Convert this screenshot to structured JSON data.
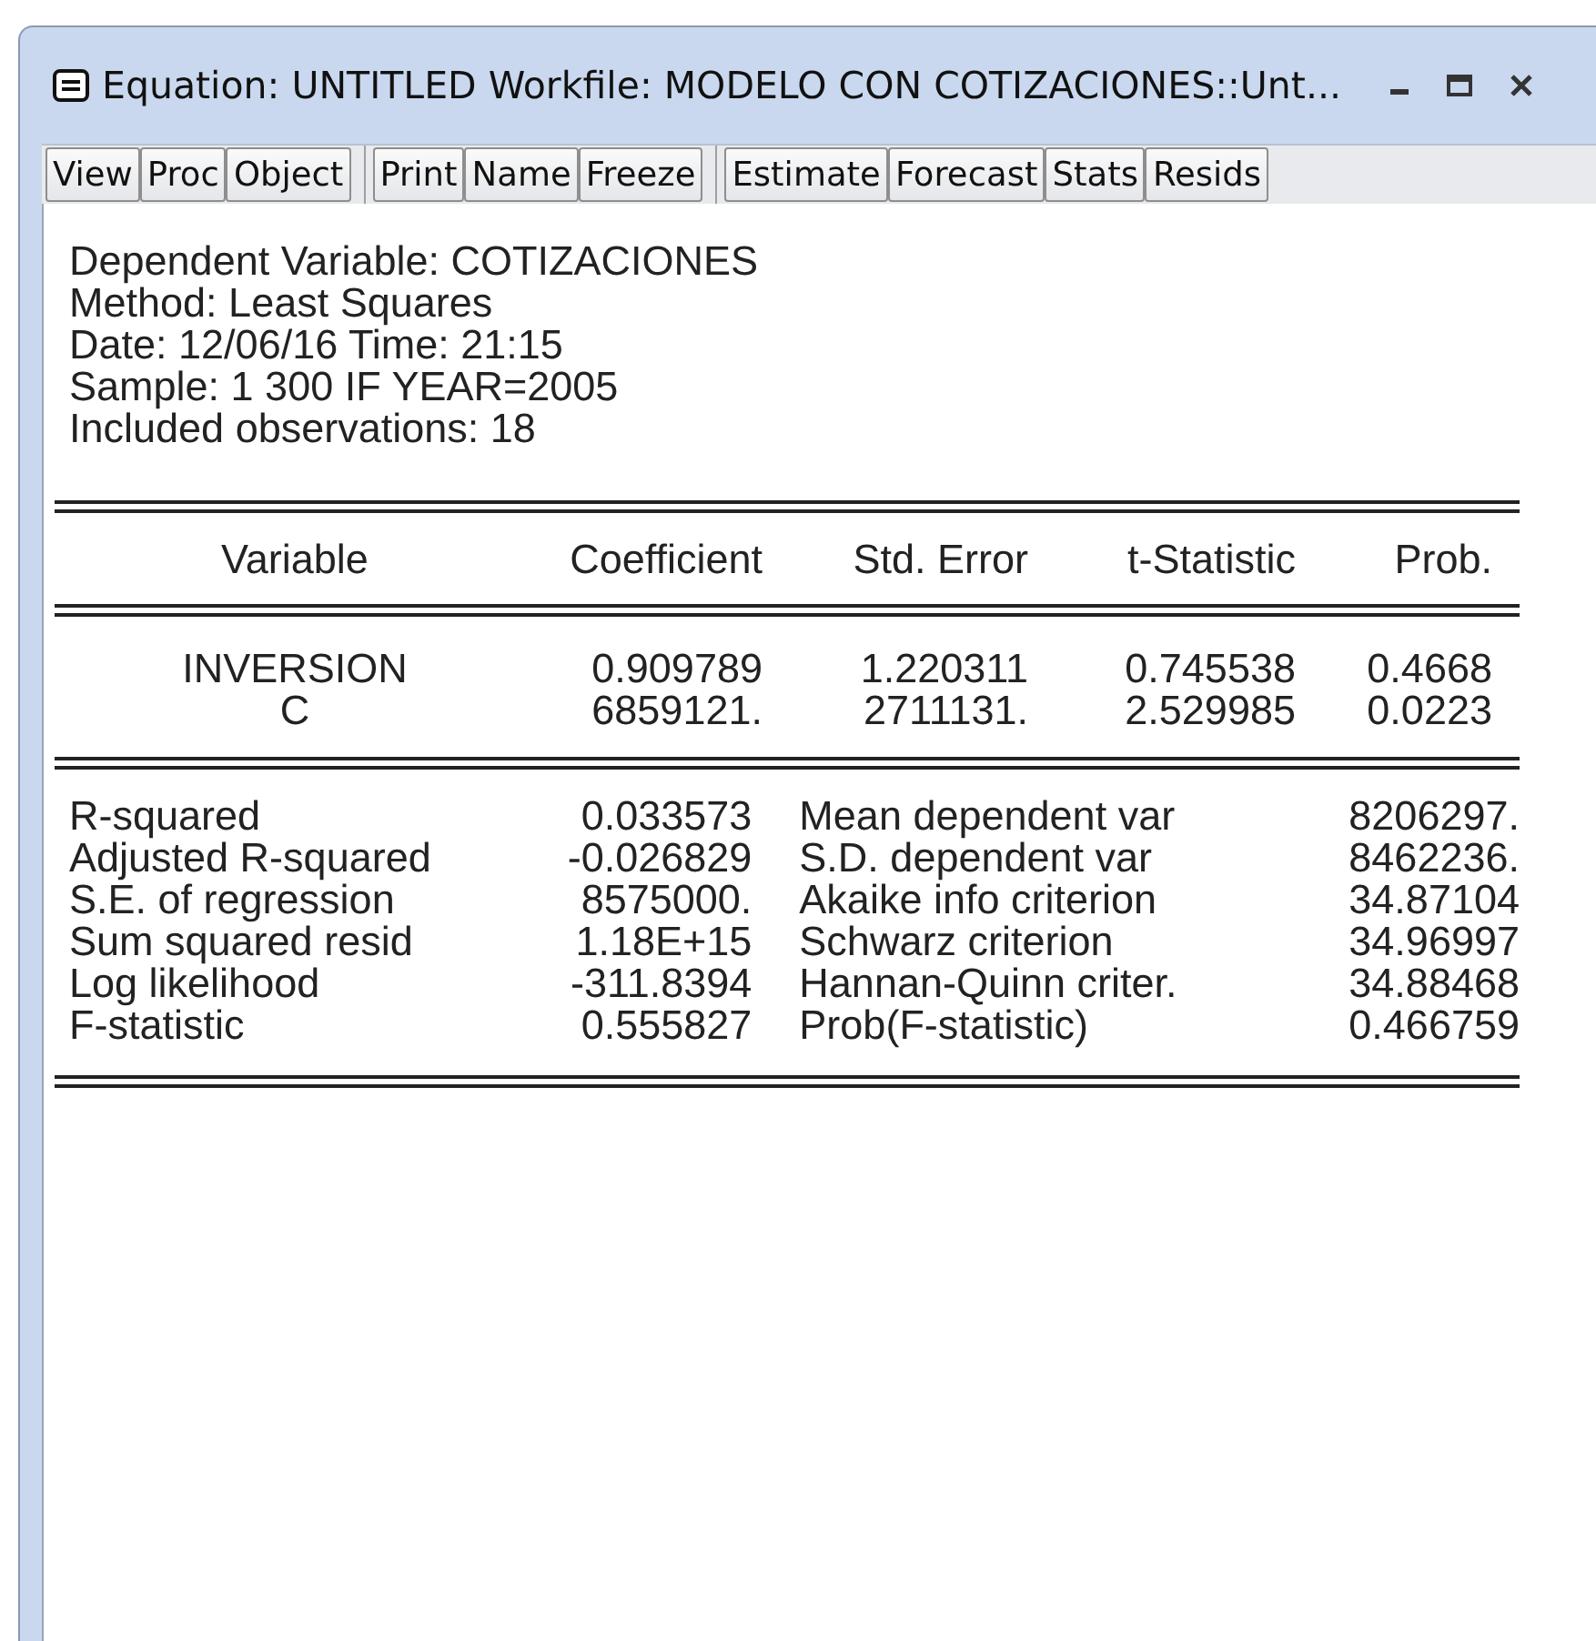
{
  "window": {
    "title": "Equation: UNTITLED   Workfile: MODELO CON COTIZACIONES::Unt..."
  },
  "toolbar": [
    [
      "View",
      "Proc",
      "Object"
    ],
    [
      "Print",
      "Name",
      "Freeze"
    ],
    [
      "Estimate",
      "Forecast",
      "Stats",
      "Resids"
    ]
  ],
  "header_lines": [
    "Dependent Variable: COTIZACIONES",
    "Method: Least Squares",
    "Date: 12/06/16   Time: 21:15",
    "Sample: 1 300 IF YEAR=2005",
    "Included observations: 18"
  ],
  "coefficients": {
    "columns": [
      "Variable",
      "Coefficient",
      "Std. Error",
      "t-Statistic",
      "Prob."
    ],
    "rows": [
      [
        "INVERSION",
        "0.909789",
        "1.220311",
        "0.745538",
        "0.4668"
      ],
      [
        "C",
        "6859121.",
        "2711131.",
        "2.529985",
        "0.0223"
      ]
    ]
  },
  "statistics": [
    [
      "R-squared",
      "0.033573",
      "Mean dependent var",
      "8206297."
    ],
    [
      "Adjusted R-squared",
      "-0.026829",
      "S.D. dependent var",
      "8462236."
    ],
    [
      "S.E. of regression",
      "8575000.",
      "Akaike info criterion",
      "34.87104"
    ],
    [
      "Sum squared resid",
      "1.18E+15",
      "Schwarz criterion",
      "34.96997"
    ],
    [
      "Log likelihood",
      "-311.8394",
      "Hannan-Quinn criter.",
      "34.88468"
    ],
    [
      "F-statistic",
      "0.555827",
      "Prob(F-statistic)",
      "0.466759"
    ]
  ]
}
